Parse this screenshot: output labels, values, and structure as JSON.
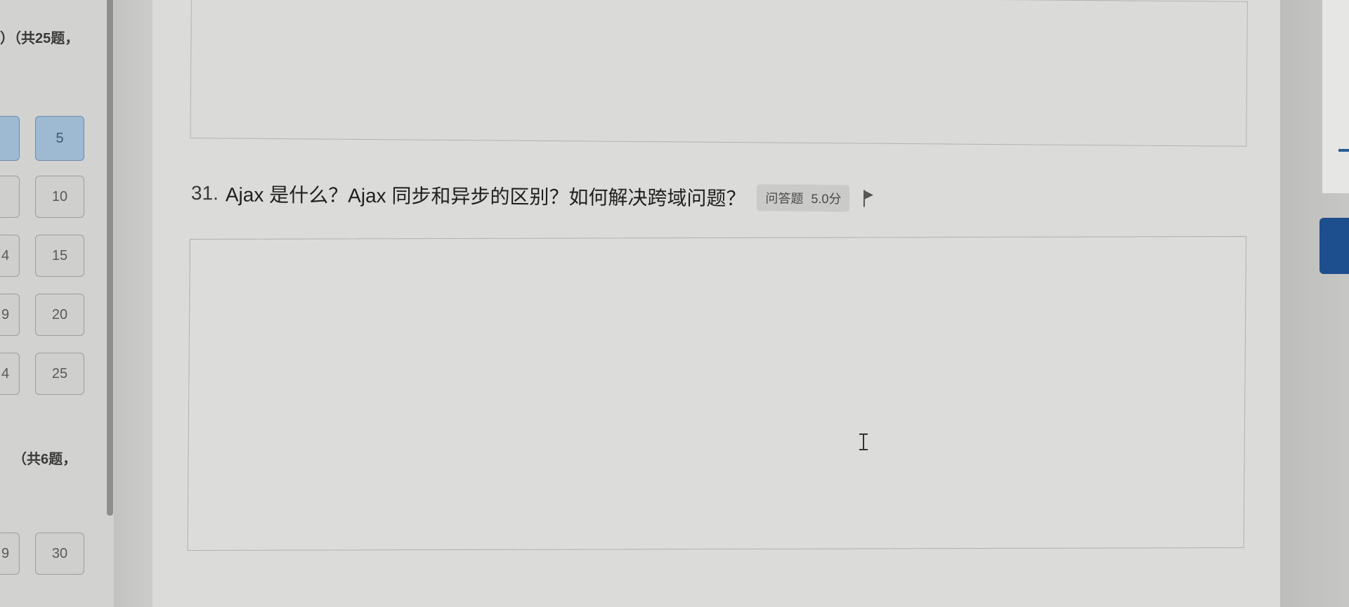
{
  "sidebar": {
    "section1_heading": "）（共25题，",
    "section2_heading": "（共6题，",
    "tiles": [
      {
        "label": "5",
        "state": "answered"
      },
      {
        "label": "10",
        "state": "unanswered"
      },
      {
        "label": "15",
        "state": "unanswered"
      },
      {
        "label": "20",
        "state": "unanswered"
      },
      {
        "label": "25",
        "state": "unanswered"
      },
      {
        "label": "30",
        "state": "unanswered"
      }
    ],
    "partial_tiles": [
      "",
      "",
      "4",
      "9",
      "4",
      "9"
    ]
  },
  "question": {
    "number": "31.",
    "text": "Ajax 是什么？Ajax 同步和异步的区别？如何解决跨域问题？",
    "type": "问答题",
    "score": "5.0分"
  },
  "answer": {
    "value": ""
  },
  "colors": {
    "answered_tile": "#9ebad3",
    "accent_blue": "#1d4f8f"
  },
  "icons": {
    "flag": "flag-icon",
    "cursor": "text-cursor-icon"
  }
}
